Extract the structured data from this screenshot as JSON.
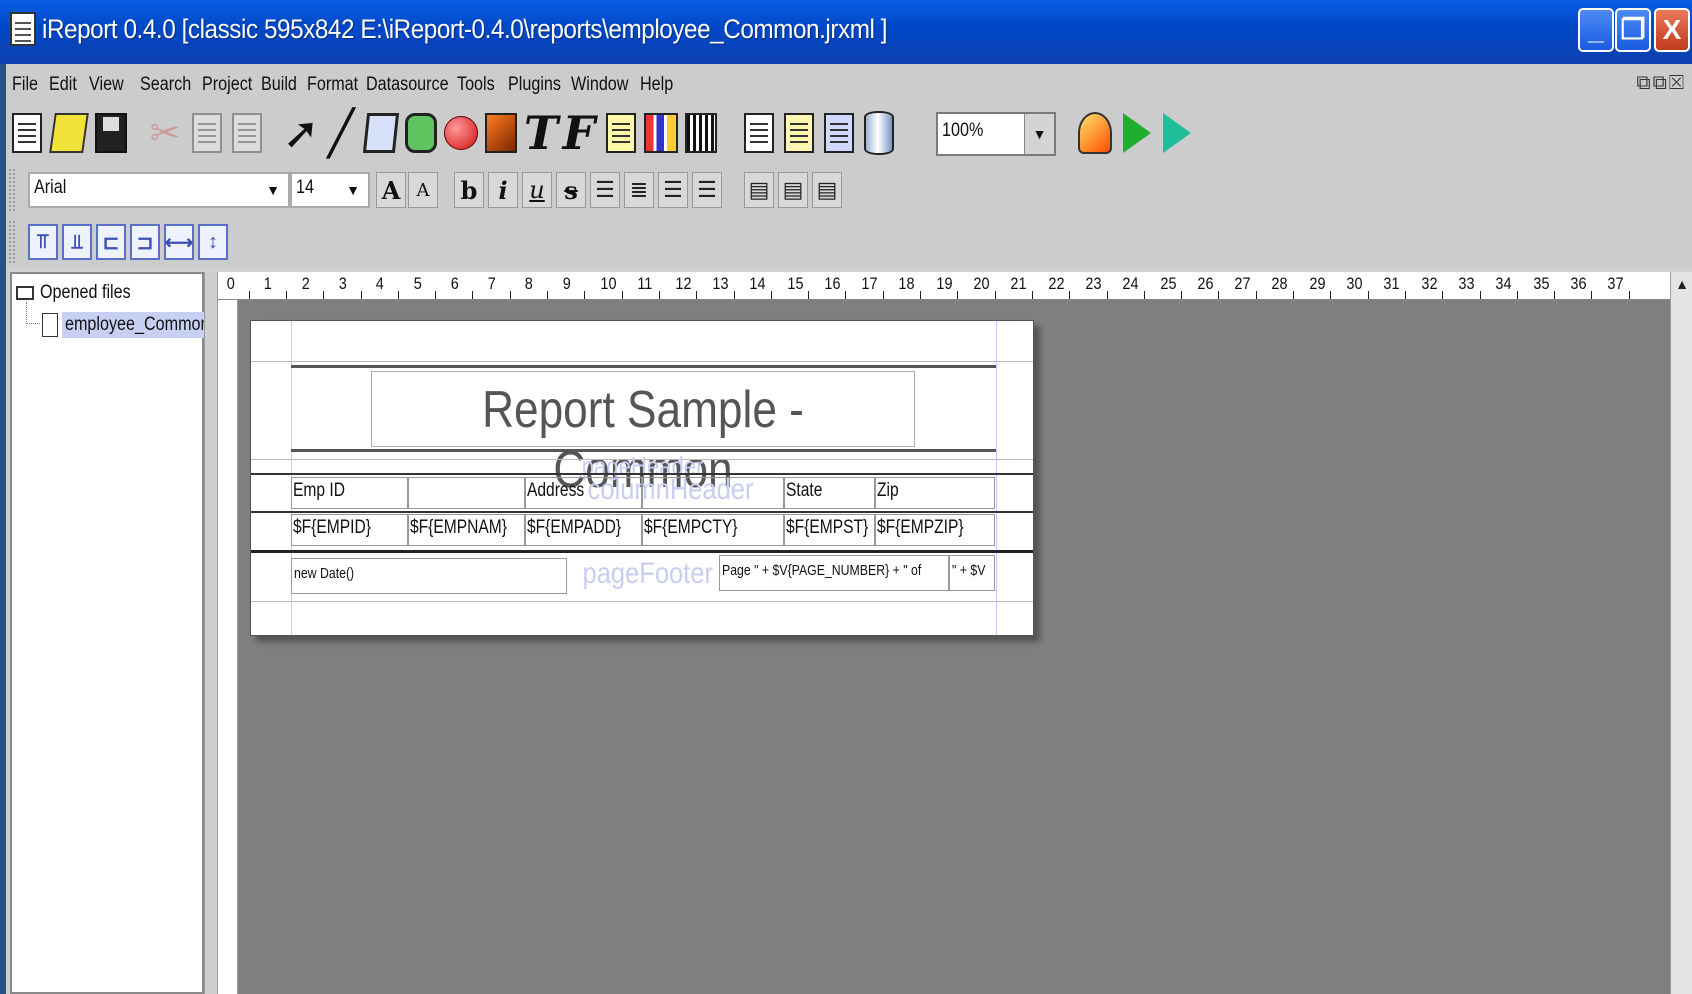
{
  "window": {
    "title": "iReport 0.4.0  [classic 595x842 E:\\iReport-0.4.0\\reports\\employee_Common.jrxml ]",
    "buttons": [
      "_",
      "❐",
      "X"
    ]
  },
  "menu": {
    "items": [
      "File",
      "Edit",
      "View",
      "Search",
      "Project",
      "Build",
      "Format",
      "Datasource",
      "Tools",
      "Plugins",
      "Window",
      "Help"
    ]
  },
  "toolbar": {
    "zoom": "100%",
    "font_name": "Arial",
    "font_size": "14",
    "glyphs": {
      "text": "T",
      "field": "F",
      "bold": "b",
      "italic": "i",
      "underline": "u",
      "strike": "s",
      "inc": "A",
      "dec": "A"
    }
  },
  "tree": {
    "root_label": "Opened files",
    "file_label": "employee_Common"
  },
  "ruler": {
    "ticks": [
      "0",
      "1",
      "2",
      "3",
      "4",
      "5",
      "6",
      "7",
      "8",
      "9",
      "10",
      "11",
      "12",
      "13",
      "14",
      "15",
      "16",
      "17",
      "18",
      "19",
      "20",
      "21",
      "22",
      "23",
      "24",
      "25",
      "26",
      "27",
      "28",
      "29",
      "30",
      "31",
      "32",
      "33",
      "34",
      "35",
      "36",
      "37"
    ]
  },
  "report": {
    "title": "Report Sample - Common",
    "band_labels": {
      "page_header": "pageHeader",
      "column_header": "columnHeader",
      "page_footer": "pageFooter"
    },
    "columns": [
      "Emp ID",
      "",
      "Address",
      "",
      "State",
      "Zip"
    ],
    "fields": [
      "$F{EMPID}",
      "$F{EMPNAM}",
      "$F{EMPADD}",
      "$F{EMPCTY}",
      "$F{EMPST}",
      "$F{EMPZIP}"
    ],
    "footer_left": "new Date()",
    "footer_page": "Page \" + $V{PAGE_NUMBER} + \" of",
    "footer_total": "\" + $V"
  }
}
